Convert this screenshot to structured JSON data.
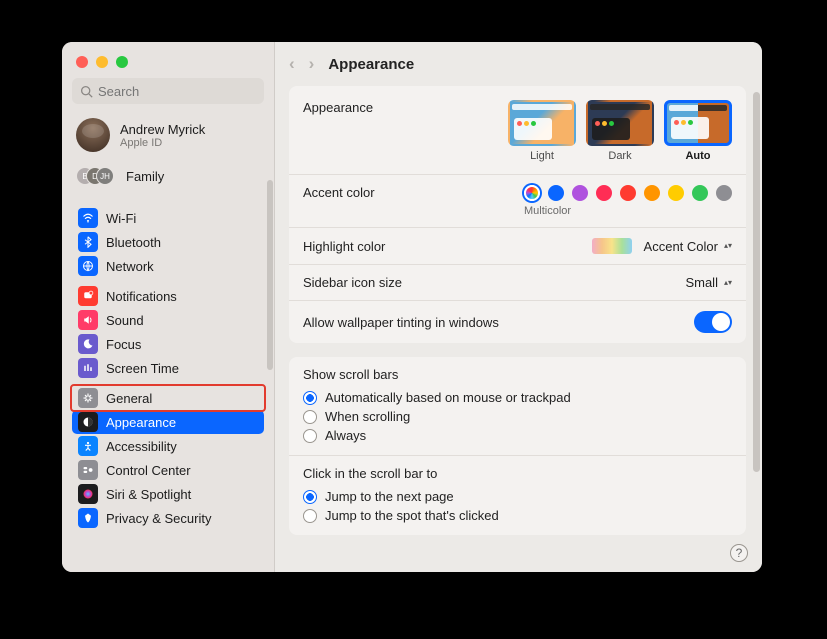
{
  "window": {
    "title": "Appearance"
  },
  "search": {
    "placeholder": "Search"
  },
  "user": {
    "name": "Andrew Myrick",
    "sub": "Apple ID"
  },
  "family": {
    "label": "Family",
    "badges": [
      "B",
      "D",
      "JH"
    ]
  },
  "sidebar": [
    {
      "id": "wifi",
      "label": "Wi-Fi",
      "color": "#0a66ff"
    },
    {
      "id": "bluetooth",
      "label": "Bluetooth",
      "color": "#0a66ff"
    },
    {
      "id": "network",
      "label": "Network",
      "color": "#0a66ff"
    },
    {
      "id": "notifications",
      "label": "Notifications",
      "color": "#ff3b30"
    },
    {
      "id": "sound",
      "label": "Sound",
      "color": "#ff3b68"
    },
    {
      "id": "focus",
      "label": "Focus",
      "color": "#6a5acd"
    },
    {
      "id": "screentime",
      "label": "Screen Time",
      "color": "#6a5acd"
    },
    {
      "id": "general",
      "label": "General",
      "color": "#8e8e93"
    },
    {
      "id": "appearance",
      "label": "Appearance",
      "color": "#1c1c1e"
    },
    {
      "id": "accessibility",
      "label": "Accessibility",
      "color": "#0a84ff"
    },
    {
      "id": "controlcenter",
      "label": "Control Center",
      "color": "#8e8e93"
    },
    {
      "id": "siri",
      "label": "Siri & Spotlight",
      "color": "#1c1c1e"
    },
    {
      "id": "privacy",
      "label": "Privacy & Security",
      "color": "#0a66ff"
    }
  ],
  "appearance": {
    "label": "Appearance",
    "options": [
      {
        "label": "Light",
        "kind": "light"
      },
      {
        "label": "Dark",
        "kind": "dark"
      },
      {
        "label": "Auto",
        "kind": "auto",
        "selected": true
      }
    ]
  },
  "accent": {
    "label": "Accent color",
    "sub": "Multicolor",
    "colors": [
      "multi",
      "#0a66ff",
      "#af52de",
      "#ff2d55",
      "#ff3b30",
      "#ff9500",
      "#ffcc00",
      "#34c759",
      "#8e8e93"
    ]
  },
  "highlight": {
    "label": "Highlight color",
    "value": "Accent Color"
  },
  "sidebarSize": {
    "label": "Sidebar icon size",
    "value": "Small"
  },
  "tinting": {
    "label": "Allow wallpaper tinting in windows",
    "on": true
  },
  "scrollbars": {
    "title": "Show scroll bars",
    "options": [
      "Automatically based on mouse or trackpad",
      "When scrolling",
      "Always"
    ],
    "selected": 0
  },
  "clickScroll": {
    "title": "Click in the scroll bar to",
    "options": [
      "Jump to the next page",
      "Jump to the spot that's clicked"
    ],
    "selected": 0
  }
}
